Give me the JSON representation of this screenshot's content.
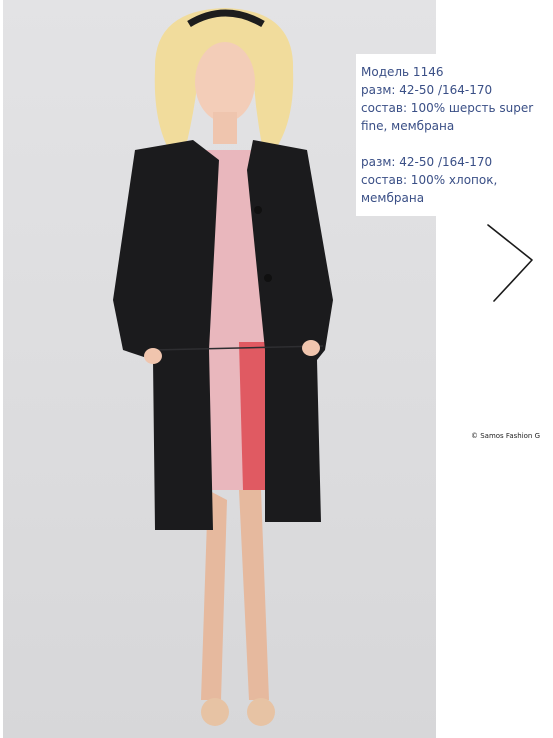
{
  "caption": {
    "model": "Модель 1146",
    "size_1": "разм: 42-50 /164-170",
    "composition_1a": "состав: 100% шерсть super",
    "composition_1b": "fine, мембрана",
    "size_2": "разм: 42-50 /164-170",
    "composition_2a": "состав: 100% хлопок,",
    "composition_2b": "мембрана"
  },
  "copyright": "© Samos Fashion G",
  "icons": {
    "next": "chevron-right-icon"
  },
  "colors": {
    "caption_text": "#3a4f86",
    "photo_bg": "#dcdcde",
    "coat": "#1b1b1d",
    "dress": "#e9b7bd",
    "dress_inset": "#e05a62"
  }
}
